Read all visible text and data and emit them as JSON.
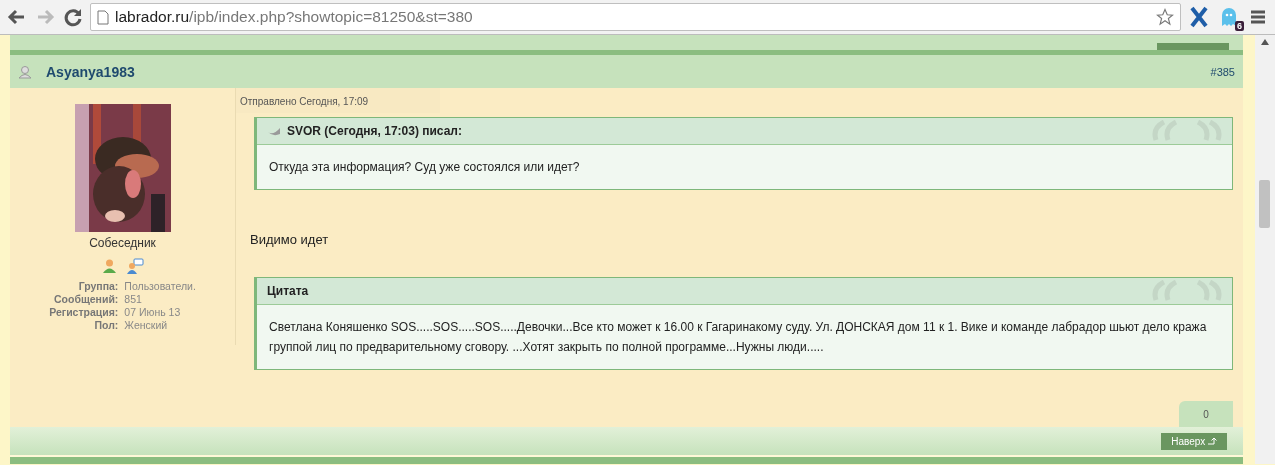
{
  "browser": {
    "url_host": "labrador.ru",
    "url_path": "/ipb/index.php?showtopic=81250&st=380",
    "extension_badge": "6"
  },
  "post": {
    "author": "Asyanya1983",
    "number": "#385",
    "sent": "Отправлено Сегодня, 17:09",
    "profile": {
      "rank": "Собеседник",
      "fields": [
        {
          "label": "Группа:",
          "value": "Пользователи."
        },
        {
          "label": "Сообщений:",
          "value": "851"
        },
        {
          "label": "Регистрация:",
          "value": "07 Июнь 13"
        },
        {
          "label": "Пол:",
          "value": "Женский"
        }
      ]
    },
    "blocks": [
      {
        "kind": "quote",
        "header": "SVOR (Сегодня, 17:03) писал:",
        "text": "Откуда эта информация? Суд уже состоялся или идет?"
      },
      {
        "kind": "text",
        "text": "Видимо идет"
      },
      {
        "kind": "citation",
        "header": "Цитата",
        "text": "Светлана Коняшенко SOS.....SOS.....SOS.....Девочки...Все кто может к 16.00 к Гагаринакому суду. Ул. ДОНСКАЯ дом 11 к 1. Вике и команде лабрадор шьют дело кража группой лиц по предварительному сговору. ...Хотят закрыть по полной программе...Нужны люди....."
      }
    ],
    "reputation": "0",
    "top_link": "Наверх"
  }
}
